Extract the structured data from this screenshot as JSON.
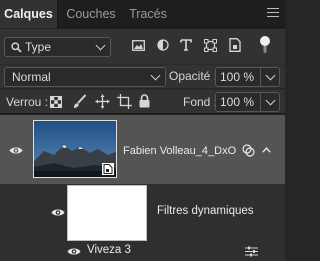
{
  "tabs": [
    {
      "label": "Calques",
      "active": true
    },
    {
      "label": "Couches",
      "active": false
    },
    {
      "label": "Tracés",
      "active": false
    }
  ],
  "filter": {
    "kind_label": "Type",
    "icons": [
      "image-filter-icon",
      "adjustment-filter-icon",
      "type-filter-icon",
      "shape-filter-icon",
      "smart-object-filter-icon",
      "filter-toggle-icon"
    ]
  },
  "blend": {
    "mode": "Normal",
    "opacity_label": "Opacité :",
    "opacity_value": "100 %"
  },
  "locks": {
    "label": "Verrou :",
    "icons": [
      "lock-transparent-pixels-icon",
      "lock-image-pixels-icon",
      "lock-position-icon",
      "lock-artboard-icon",
      "lock-all-icon"
    ],
    "fill_label": "Fond :",
    "fill_value": "100 %"
  },
  "layers": [
    {
      "name": "Fabien Volleau_4_DxO",
      "selected": true,
      "visible": true
    },
    {
      "name": "Filtres dynamiques",
      "selected": false,
      "visible": true
    },
    {
      "name": "Viveza 3",
      "selected": false,
      "visible": true
    }
  ],
  "colors": {
    "panel_bg": "#262626",
    "selected_row": "#545454",
    "toolbar_bg": "#323232"
  }
}
